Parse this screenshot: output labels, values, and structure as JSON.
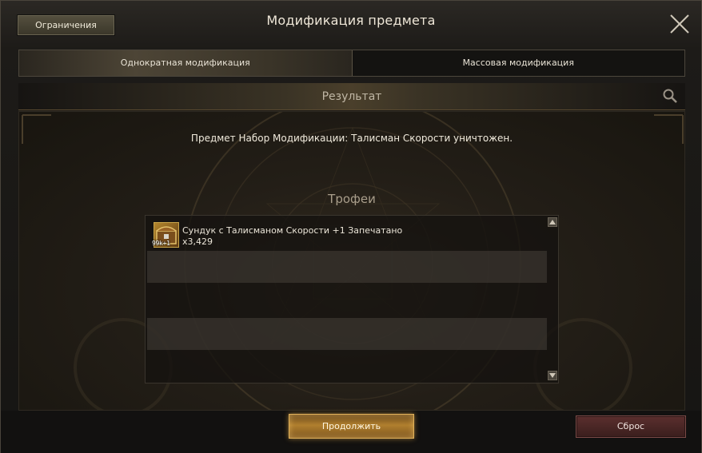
{
  "window": {
    "title": "Модификация предмета",
    "restrictions_label": "Ограничения"
  },
  "tabs": [
    {
      "label": "Однократная модификация",
      "active": true
    },
    {
      "label": "Массовая модификация",
      "active": false
    }
  ],
  "result": {
    "header": "Результат",
    "message": "Предмет Набор Модификации: Талисман Скорости уничтожен.",
    "trophies_title": "Трофеи",
    "items": [
      {
        "name": "Сундук с Талисманом Скорости +1 Запечатано",
        "quantity": "x3,429",
        "badge": "99k+1",
        "icon": "chest-icon"
      }
    ]
  },
  "footer": {
    "continue_label": "Продолжить",
    "reset_label": "Сброс"
  },
  "colors": {
    "accent": "#e0b15a",
    "reset": "#5b2f2e"
  }
}
